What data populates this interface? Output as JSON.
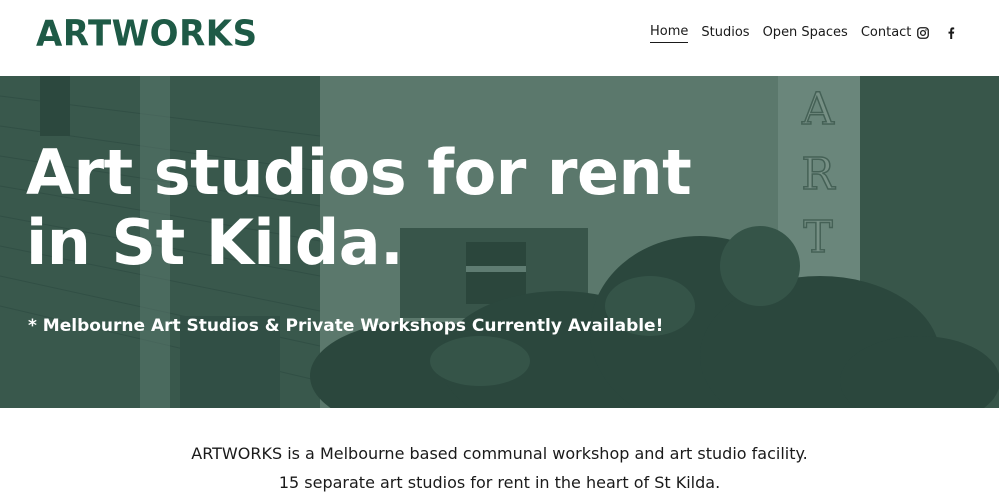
{
  "header": {
    "logo": "ARTWORKS",
    "nav": [
      {
        "label": "Home",
        "active": true
      },
      {
        "label": "Studios",
        "active": false
      },
      {
        "label": "Open Spaces",
        "active": false
      },
      {
        "label": "Contact",
        "active": false
      }
    ],
    "social": [
      "instagram-icon",
      "facebook-icon"
    ]
  },
  "hero": {
    "title_line1": "Art studios for rent",
    "title_line2": "in St Kilda.",
    "subtitle": "* Melbourne Art Studios & Private Workshops Currently Available!",
    "sign_letters": [
      "A",
      "R",
      "T"
    ]
  },
  "intro": {
    "line1": "ARTWORKS is a Melbourne based communal workshop and art studio facility.",
    "line2": "15 separate art studios for rent in the heart of St Kilda."
  },
  "colors": {
    "brand": "#1e5a46",
    "hero_tint": "#4e6d60"
  }
}
